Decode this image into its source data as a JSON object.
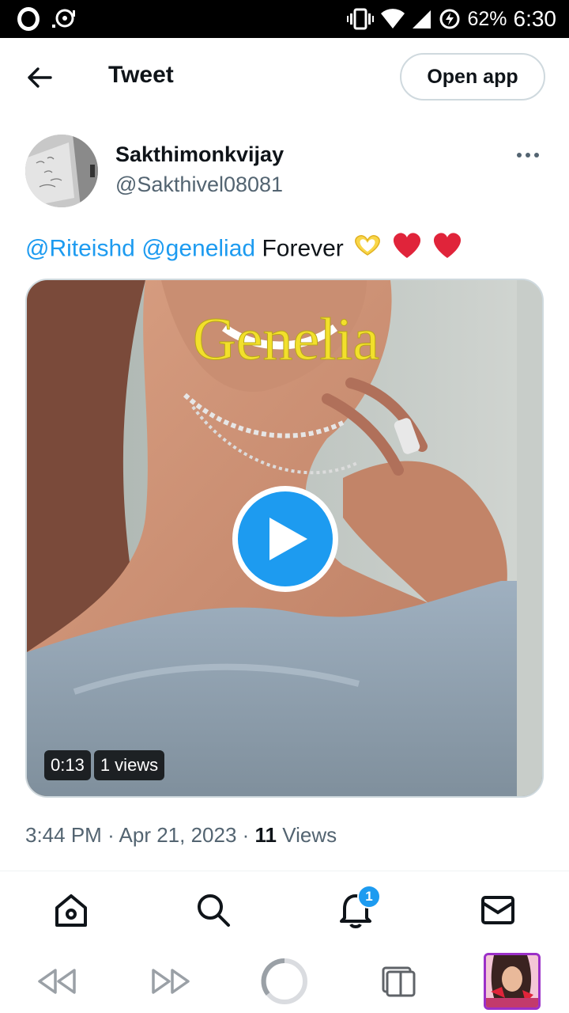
{
  "status_bar": {
    "battery": "62%",
    "time": "6:30"
  },
  "header": {
    "title": "Tweet",
    "open_app_label": "Open app"
  },
  "tweet": {
    "display_name": "Sakthimonkvijay",
    "handle": "@Sakthivel08081",
    "mention_1": "@Riteishd",
    "mention_2": "@geneliad",
    "text": "Forever",
    "media": {
      "title_overlay": "Genelia",
      "duration": "0:13",
      "views": "1 views"
    },
    "time": "3:44 PM",
    "date": "Apr 21, 2023",
    "view_count": "11",
    "views_label": "Views"
  },
  "nav": {
    "notification_count": "1"
  },
  "colors": {
    "accent": "#1d9bf0",
    "text": "#0f1419",
    "secondary": "#536471",
    "heart": "#e0243a",
    "title_yellow": "#f2e02b"
  },
  "icons": {
    "back": "arrow-left-icon",
    "more": "more-dots-icon",
    "play": "play-icon",
    "home": "home-icon",
    "search": "search-icon",
    "notifications": "bell-icon",
    "messages": "mail-icon",
    "browser_back": "rewind-icon",
    "browser_forward": "fast-forward-icon",
    "browser_home": "opera-ring-icon",
    "browser_tabs": "tabs-icon"
  }
}
